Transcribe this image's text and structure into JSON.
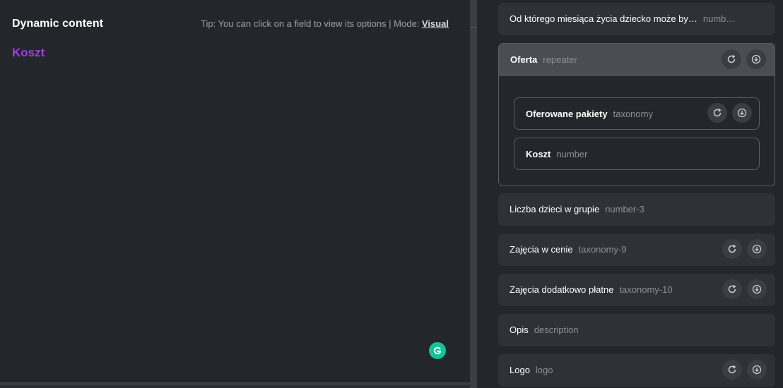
{
  "left": {
    "title": "Dynamic content",
    "tip_prefix": "Tip: You can click on a field to view its options | Mode: ",
    "mode": "Visual",
    "selected_value": "Koszt"
  },
  "fields": [
    {
      "name": "Od którego miesiąca życia dziecko może by…",
      "type": "numb…"
    },
    {
      "name": "Oferta",
      "type": "repeater"
    },
    {
      "name": "Oferowane pakiety",
      "type": "taxonomy"
    },
    {
      "name": "Koszt",
      "type": "number"
    },
    {
      "name": "Liczba dzieci w grupie",
      "type": "number-3"
    },
    {
      "name": "Zajęcia w cenie",
      "type": "taxonomy-9"
    },
    {
      "name": "Zajęcia dodatkowo płatne",
      "type": "taxonomy-10"
    },
    {
      "name": "Opis",
      "type": "description"
    },
    {
      "name": "Logo",
      "type": "logo"
    }
  ],
  "icons": {
    "refresh": "refresh-icon",
    "download": "download-icon",
    "grammarly": "grammarly-icon"
  },
  "colors": {
    "accent_purple": "#a538e8",
    "grammarly_green": "#15c39a"
  }
}
